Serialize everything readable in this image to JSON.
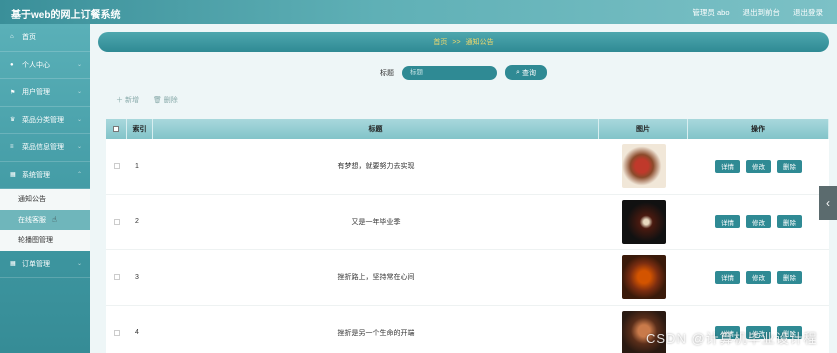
{
  "header": {
    "title": "基于web的网上订餐系统",
    "admin": "管理员 abo",
    "back_to_front": "退出到前台",
    "logout": "退出登录"
  },
  "sidebar": {
    "items": [
      {
        "label": "首页",
        "icon": "home-icon"
      },
      {
        "label": "个人中心",
        "icon": "user-icon"
      },
      {
        "label": "用户管理",
        "icon": "flag-icon"
      },
      {
        "label": "菜品分类管理",
        "icon": "trophy-icon"
      },
      {
        "label": "菜品信息管理",
        "icon": "list-icon"
      },
      {
        "label": "系统管理",
        "icon": "grid-icon"
      }
    ],
    "submenu": [
      {
        "label": "通知公告"
      },
      {
        "label": "在线客服"
      },
      {
        "label": "轮播图管理"
      }
    ],
    "after": [
      {
        "label": "订单管理",
        "icon": "grid-icon"
      }
    ]
  },
  "breadcrumb": {
    "home": "首页",
    "sep": ">>",
    "current": "通知公告"
  },
  "search": {
    "label": "标题",
    "placeholder": "标题",
    "button": "查询"
  },
  "toolbar": {
    "add": "新增",
    "delete": "删除"
  },
  "table": {
    "headers": {
      "index": "索引",
      "title": "标题",
      "image": "图片",
      "ops": "操作"
    },
    "rows": [
      {
        "index": "1",
        "title": "有梦想，就要努力去实现"
      },
      {
        "index": "2",
        "title": "又是一年毕业季"
      },
      {
        "index": "3",
        "title": "挫折路上，坚持常在心间"
      },
      {
        "index": "4",
        "title": "挫折是另一个生命的开端"
      }
    ],
    "actions": {
      "detail": "详情",
      "edit": "修改",
      "delete": "删除"
    }
  },
  "watermark": "CSDN @计算机毕业设计程"
}
